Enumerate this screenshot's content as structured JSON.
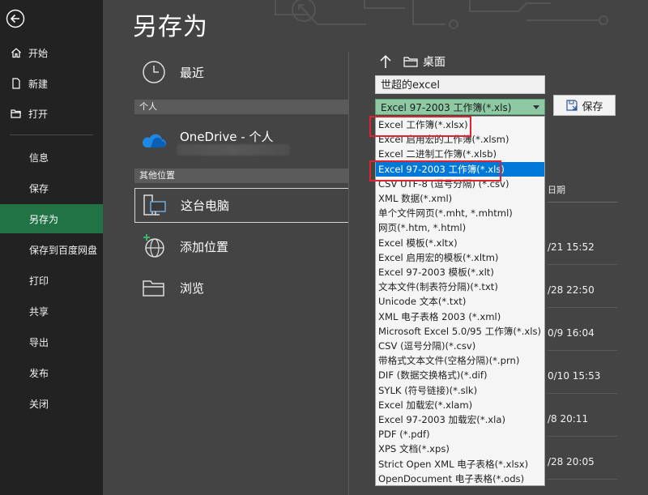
{
  "colors": {
    "accent": "#217346",
    "sidebar": "#222222",
    "main": "#444444",
    "selection": "#0078d7",
    "highlight": "#e0242f"
  },
  "sidebar": {
    "back_icon": "back-arrow-icon",
    "items": [
      {
        "label": "开始",
        "icon": "home-icon"
      },
      {
        "label": "新建",
        "icon": "new-document-icon"
      },
      {
        "label": "打开",
        "icon": "open-folder-icon"
      },
      {
        "label": "信息"
      },
      {
        "label": "保存"
      },
      {
        "label": "另存为",
        "active": true
      },
      {
        "label": "保存到百度网盘"
      },
      {
        "label": "打印"
      },
      {
        "label": "共享"
      },
      {
        "label": "导出"
      },
      {
        "label": "发布"
      },
      {
        "label": "关闭"
      }
    ]
  },
  "page_title": "另存为",
  "locations": {
    "recent": "最近",
    "personal_header": "个人",
    "onedrive": "OneDrive - 个人",
    "other_header": "其他位置",
    "this_pc": "这台电脑",
    "add_place": "添加位置",
    "browse": "浏览"
  },
  "save_panel": {
    "current_path": "桌面",
    "filename": "世超的excel",
    "filetype": "Excel 97-2003 工作簿(*.xls)",
    "save_label": "保存"
  },
  "file_list": {
    "date_header": "日期",
    "times": [
      "/21 15:52",
      "/28 22:50",
      "0/9 16:04",
      "0/10 15:53",
      "/8 20:11",
      "/28 20:05"
    ]
  },
  "filetype_options": [
    "Excel 工作簿(*.xlsx)",
    "Excel 启用宏的工作簿(*.xlsm)",
    "Excel 二进制工作簿(*.xlsb)",
    "Excel 97-2003 工作簿(*.xls)",
    "CSV UTF-8 (逗号分隔) (*.csv)",
    "XML 数据(*.xml)",
    "单个文件网页(*.mht, *.mhtml)",
    "网页(*.htm, *.html)",
    "Excel 模板(*.xltx)",
    "Excel 启用宏的模板(*.xltm)",
    "Excel 97-2003 模板(*.xlt)",
    "文本文件(制表符分隔)(*.txt)",
    "Unicode 文本(*.txt)",
    "XML 电子表格 2003 (*.xml)",
    "Microsoft Excel 5.0/95 工作簿(*.xls)",
    "CSV (逗号分隔)(*.csv)",
    "带格式文本文件(空格分隔)(*.prn)",
    "DIF (数据交换格式)(*.dif)",
    "SYLK (符号链接)(*.slk)",
    "Excel 加载宏(*.xlam)",
    "Excel 97-2003 加载宏(*.xla)",
    "PDF (*.pdf)",
    "XPS 文档(*.xps)",
    "Strict Open XML 电子表格(*.xlsx)",
    "OpenDocument 电子表格(*.ods)"
  ],
  "selected_option_index": 3,
  "highlighted_option_indices": [
    0,
    3
  ]
}
